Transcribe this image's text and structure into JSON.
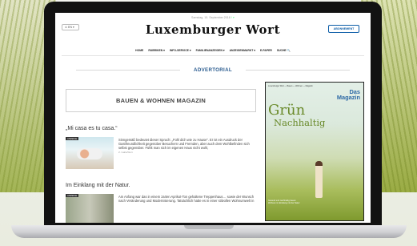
{
  "header": {
    "date_line": "Samstag, 15. September 2018",
    "social": "f ♥",
    "lang_button": "⊙ EN ▾",
    "logo": "Luxemburger Wort",
    "subscribe_button": "ABONNEMENT"
  },
  "nav": {
    "items": [
      {
        "label": "HOME"
      },
      {
        "label": "RUBRIKEN ▾"
      },
      {
        "label": "INFO-SERVICE ▾"
      },
      {
        "label": "FAMILIENANZEIGEN ▾"
      },
      {
        "label": "ANZEIGENMARKT ▾"
      },
      {
        "label": "E-PAPER"
      },
      {
        "label": "SUCHE 🔍"
      }
    ]
  },
  "main": {
    "advertorial_label": "ADVERTORIAL",
    "magazine_title": "BAUEN & WOHNEN MAGAZIN",
    "articles": [
      {
        "title": "„Mi casa es tu casa.“",
        "tag": "ANZEIGE",
        "text": "Sinngemäß bedeutet dieser Spruch: „Fühl dich wie zu Hause“. Er ist ein Ausdruck der Gastfreundlichkeit gegenüber Besuchern und Fremden, aber auch dem Wohlbefinden sich selbst gegenüber. Fühlt man sich im eigenen Haus nicht wohl,",
        "author": "Z. Gallo/Wort"
      },
      {
        "title": "Im Einklang mit der Natur.",
        "tag": "ANZEIGE",
        "text": "Am Anfang war das in einem zarten Aprikot-Ton gehaltene Treppenhaus… sowie der Wunsch nach Veränderung und Modernisierung. Tatsächlich hatte es in einer stilvollen Wohnumwelt in",
        "author": ""
      }
    ]
  },
  "ad": {
    "top_text": "Luxemburger Wort — Bauen — Wohnen — Magazin",
    "brand_line1": "Das",
    "brand_line2": "Magazin",
    "headline1": "Grün",
    "headline2": "Nachhaltig",
    "footer": "Gesund und nachhaltig bauen Wohnen im Einklang mit der Natur"
  }
}
